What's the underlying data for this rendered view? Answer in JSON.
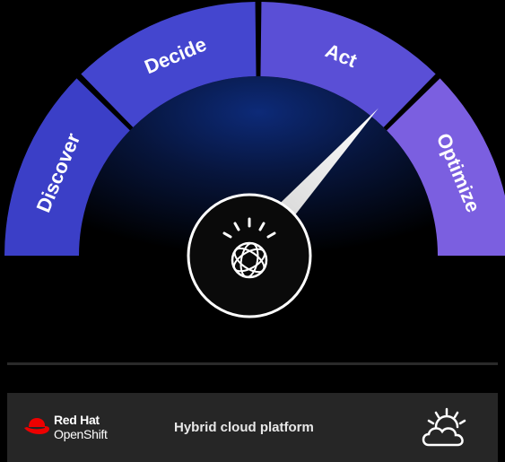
{
  "gauge": {
    "segments": [
      {
        "label": "Discover",
        "color": "#3b3fc7"
      },
      {
        "label": "Decide",
        "color": "#4446cf"
      },
      {
        "label": "Act",
        "color": "#5a4fd6"
      },
      {
        "label": "Optimize",
        "color": "#7b5fe0"
      }
    ],
    "active_segment": "Act",
    "center_icon": "ibm-watson-icon"
  },
  "platform_bar": {
    "brand_line1": "Red Hat",
    "brand_line2": "OpenShift",
    "brand_icon": "red-hat-icon",
    "label": "Hybrid cloud platform",
    "icon": "cloud-sun-icon"
  },
  "colors": {
    "background": "#000000",
    "bar": "#262626",
    "pointer": "#ffffff",
    "red_hat": "#ee0000"
  }
}
